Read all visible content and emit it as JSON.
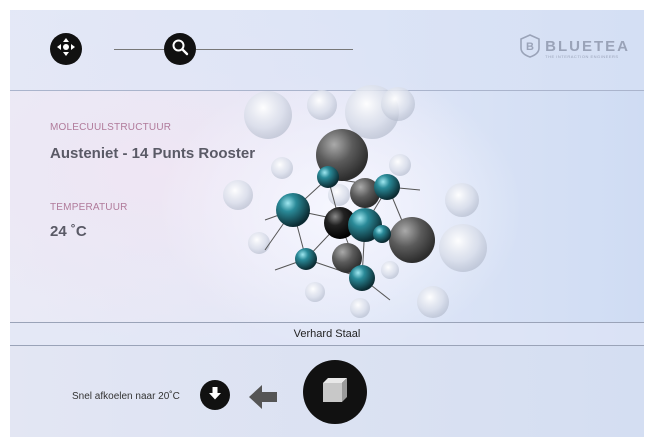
{
  "brand": {
    "name": "BLUETEA",
    "tagline": "THE INTERACTION ENGINEERS",
    "badge_letter": "B"
  },
  "info": {
    "structure_label": "MOLECUULSTRUCTUUR",
    "structure_value": "Austeniet - 14 Punts Rooster",
    "temperature_label": "TEMPERATUUR",
    "temperature_value": "24  ˚C"
  },
  "status": {
    "material": "Verhard Staal"
  },
  "actions": {
    "cool_label": "Snel afkoelen naar 20˚C"
  },
  "icons": {
    "move": "move-arrows-icon",
    "search": "magnifier-icon",
    "cool": "arrow-down-icon",
    "direction": "arrow-left-icon",
    "cube": "cube-icon"
  },
  "colors": {
    "atom_teal": "#1d6f7d",
    "atom_dark": "#1a1a1a",
    "atom_grey": "#5b5b5b",
    "label": "#b07a9a",
    "value": "#5a5a66"
  }
}
